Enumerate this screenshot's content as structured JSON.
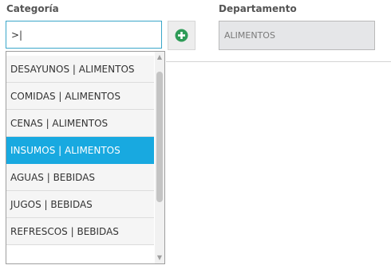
{
  "form": {
    "categoria_label": "Categoría",
    "categoria_value": ">|",
    "add_icon": "plus-circle-icon",
    "departamento_label": "Departamento",
    "departamento_value": "ALIMENTOS"
  },
  "dropdown": {
    "items": [
      {
        "label": "DESAYUNOS | ALIMENTOS",
        "selected": false
      },
      {
        "label": "COMIDAS | ALIMENTOS",
        "selected": false
      },
      {
        "label": "CENAS | ALIMENTOS",
        "selected": false
      },
      {
        "label": "INSUMOS | ALIMENTOS",
        "selected": true
      },
      {
        "label": "AGUAS | BEBIDAS",
        "selected": false
      },
      {
        "label": "JUGOS | BEBIDAS",
        "selected": false
      },
      {
        "label": "REFRESCOS | BEBIDAS",
        "selected": false
      }
    ]
  },
  "colors": {
    "accent": "#18a9e0",
    "add_icon": "#2e9b57"
  }
}
